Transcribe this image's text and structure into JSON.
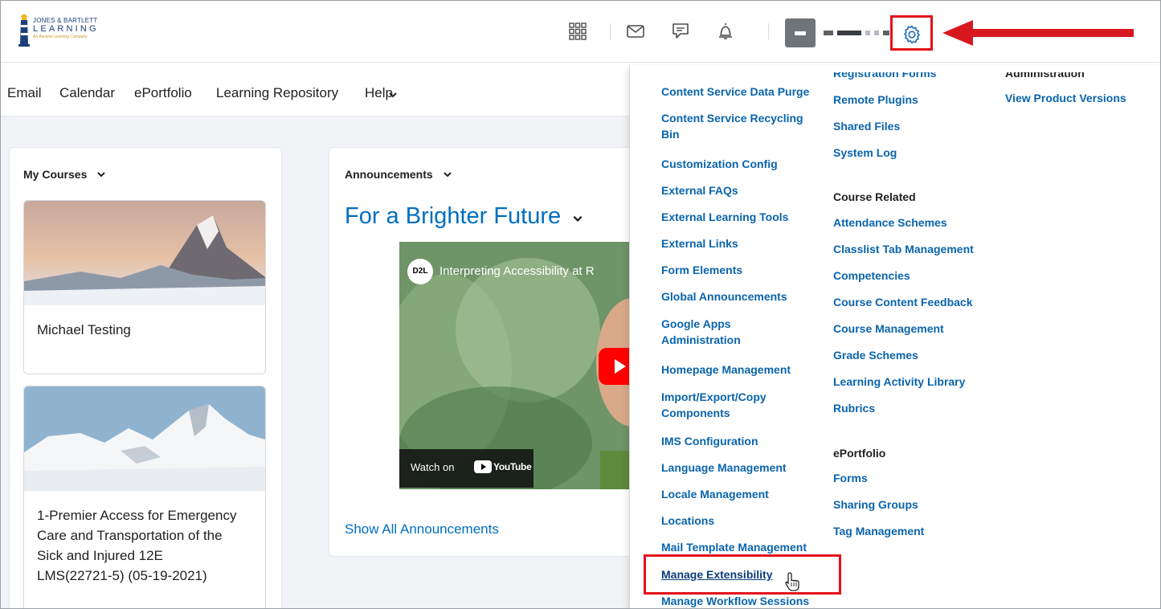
{
  "brand": {
    "logo_line1": "JONES & BARTLETT",
    "logo_line2": "LEARNING",
    "logo_line3": "An Ascend Learning Company"
  },
  "header_icons": [
    "apps-grid-icon",
    "email-icon",
    "chat-icon",
    "notification-bell-icon",
    "avatar",
    "gear-icon"
  ],
  "nav": {
    "items": [
      "Email",
      "Calendar",
      "ePortfolio",
      "Learning Repository",
      "Help"
    ]
  },
  "my_courses": {
    "title": "My Courses",
    "courses": [
      {
        "name": "Michael Testing"
      },
      {
        "name_lines": [
          "1-Premier Access for Emergency",
          "Care and Transportation of the",
          "Sick and Injured 12E",
          "LMS(22721-5) (05-19-2021)"
        ]
      }
    ]
  },
  "announcements": {
    "title": "Announcements",
    "headline": "For a Brighter Future",
    "video": {
      "logo": "D2L",
      "title": "Interpreting Accessibility at R",
      "watch_on": "Watch on",
      "youtube": "YouTube"
    },
    "show_all": "Show All Announcements"
  },
  "admin_menu": {
    "col1": [
      "Content Service Data Purge",
      "Content Service Recycling Bin",
      "Customization Config",
      "External FAQs",
      "External Learning Tools",
      "External Links",
      "Form Elements",
      "Global Announcements",
      "Google Apps Administration",
      "Homepage Management",
      "Import/Export/Copy Components",
      "IMS Configuration",
      "Language Management",
      "Locale Management",
      "Locations",
      "Mail Template Management",
      "Manage Extensibility",
      "Manage Workflow Sessions"
    ],
    "col1_wrapped": {
      "recycling": [
        "Content Service Recycling",
        "Bin"
      ],
      "google": [
        "Google Apps",
        "Administration"
      ],
      "import": [
        "Import/Export/Copy",
        "Components"
      ]
    },
    "col2_top": [
      "Registration Forms",
      "Remote Plugins",
      "Shared Files",
      "System Log"
    ],
    "course_related": {
      "heading": "Course Related",
      "items": [
        "Attendance Schemes",
        "Classlist Tab Management",
        "Competencies",
        "Course Content Feedback",
        "Course Management",
        "Grade Schemes",
        "Learning Activity Library",
        "Rubrics"
      ]
    },
    "eportfolio": {
      "heading": "ePortfolio",
      "items": [
        "Forms",
        "Sharing Groups",
        "Tag Management"
      ]
    },
    "col3": {
      "heading": "Administration",
      "items": [
        "View Product Versions"
      ]
    }
  },
  "colors": {
    "link": "#0a64ad",
    "highlight": "#e3121a",
    "accent_blue": "#006fbf"
  }
}
